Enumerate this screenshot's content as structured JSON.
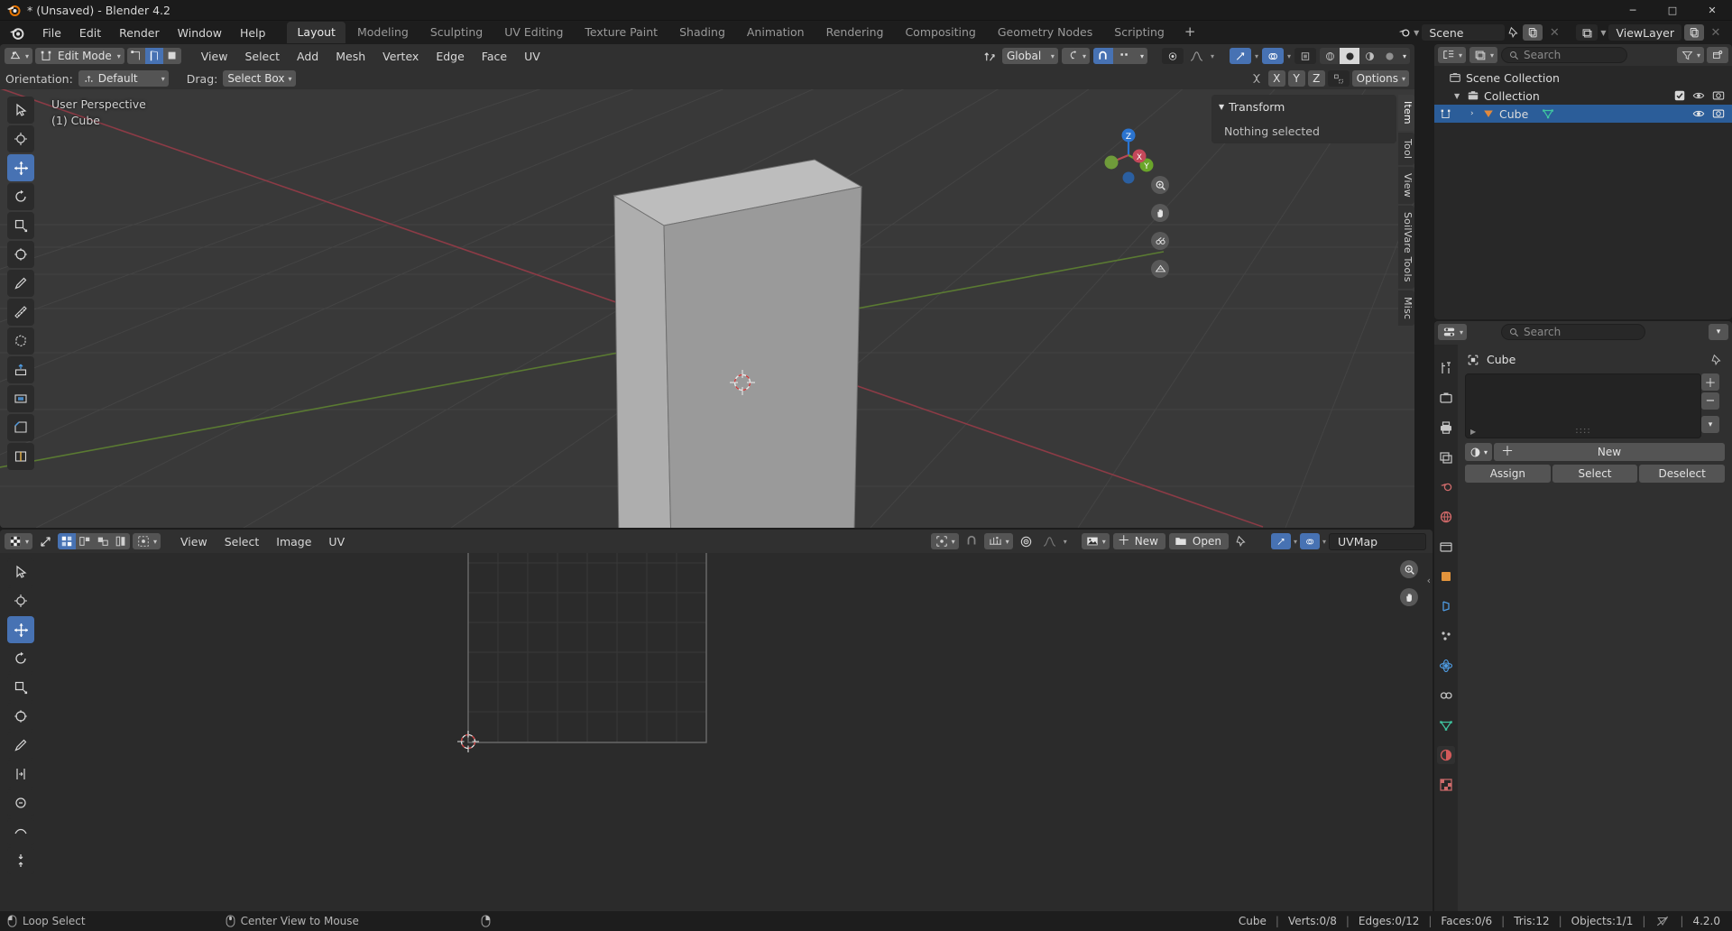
{
  "window": {
    "title": "* (Unsaved) - Blender 4.2",
    "minimize": "─",
    "maximize": "□",
    "close": "✕"
  },
  "topbar": {
    "menus": [
      "File",
      "Edit",
      "Render",
      "Window",
      "Help"
    ],
    "workspaces": [
      {
        "label": "Layout",
        "active": true
      },
      {
        "label": "Modeling",
        "active": false
      },
      {
        "label": "Sculpting",
        "active": false
      },
      {
        "label": "UV Editing",
        "active": false
      },
      {
        "label": "Texture Paint",
        "active": false
      },
      {
        "label": "Shading",
        "active": false
      },
      {
        "label": "Animation",
        "active": false
      },
      {
        "label": "Rendering",
        "active": false
      },
      {
        "label": "Compositing",
        "active": false
      },
      {
        "label": "Geometry Nodes",
        "active": false
      },
      {
        "label": "Scripting",
        "active": false
      }
    ],
    "add_workspace": "+",
    "scene_name": "Scene",
    "viewlayer_name": "ViewLayer"
  },
  "viewport3d": {
    "mode": "Edit Mode",
    "menus": [
      "View",
      "Select",
      "Add",
      "Mesh",
      "Vertex",
      "Edge",
      "Face",
      "UV"
    ],
    "mesh_select_modes": [
      {
        "name": "vertex-select-mode",
        "active": false
      },
      {
        "name": "edge-select-mode",
        "active": true
      },
      {
        "name": "face-select-mode",
        "active": false
      }
    ],
    "transform_orientation": "Global",
    "overlay_label": "",
    "toolsettings": {
      "orientation_label": "Orientation:",
      "orientation_value": "Default",
      "drag_label": "Drag:",
      "drag_value": "Select Box",
      "proportional_axes": [
        "X",
        "Y",
        "Z"
      ],
      "options_label": "Options"
    },
    "overlay_text_line1": "User Perspective",
    "overlay_text_line2": "(1) Cube",
    "gizmo_axes": {
      "z": "Z",
      "y": "Y",
      "x": "X"
    },
    "sidebar": {
      "panel_title": "Transform",
      "panel_body": "Nothing selected",
      "tabs": [
        "Item",
        "Tool",
        "View",
        "SoilVare Tools",
        "Misc"
      ]
    },
    "tools": [
      {
        "name": "tweak-tool",
        "active": false
      },
      {
        "name": "cursor-tool",
        "active": false
      },
      {
        "name": "move-tool",
        "active": true
      },
      {
        "name": "rotate-tool",
        "active": false
      },
      {
        "name": "scale-tool",
        "active": false
      },
      {
        "name": "transform-tool",
        "active": false
      },
      {
        "name": "annotate-tool",
        "active": false
      },
      {
        "name": "measure-tool",
        "active": false
      },
      {
        "name": "add-cube-tool",
        "active": false
      },
      {
        "name": "extrude-region-tool",
        "active": false
      },
      {
        "name": "inset-faces-tool",
        "active": false
      },
      {
        "name": "bevel-tool",
        "active": false
      },
      {
        "name": "loop-cut-tool",
        "active": false
      }
    ]
  },
  "uveditor": {
    "menus": [
      "View",
      "Select",
      "Image",
      "UV"
    ],
    "uv_select_modes": [
      {
        "name": "uv-vertex-select",
        "active": true
      },
      {
        "name": "uv-edge-select",
        "active": false
      },
      {
        "name": "uv-face-select",
        "active": false
      },
      {
        "name": "uv-island-select",
        "active": false
      }
    ],
    "new_label": "New",
    "open_label": "Open",
    "uvmap_name": "UVMap",
    "tools": [
      {
        "name": "uv-tweak-tool",
        "active": false
      },
      {
        "name": "uv-cursor-tool",
        "active": false
      },
      {
        "name": "uv-move-tool",
        "active": true
      },
      {
        "name": "uv-rotate-tool",
        "active": false
      },
      {
        "name": "uv-scale-tool",
        "active": false
      },
      {
        "name": "uv-transform-tool",
        "active": false
      },
      {
        "name": "uv-annotate-tool",
        "active": false
      },
      {
        "name": "uv-rip-region-tool",
        "active": false
      },
      {
        "name": "uv-grab-tool",
        "active": false
      },
      {
        "name": "uv-relax-tool",
        "active": false
      },
      {
        "name": "uv-pinch-tool",
        "active": false
      }
    ]
  },
  "outliner": {
    "search_placeholder": "Search",
    "rows": [
      {
        "label": "Scene Collection",
        "indent": 0,
        "icon": "collection-icon",
        "selected": false,
        "has_expand": false,
        "checkbox": false,
        "eye": false,
        "camera": false
      },
      {
        "label": "Collection",
        "indent": 1,
        "icon": "collection-icon",
        "selected": false,
        "has_expand": true,
        "checkbox": true,
        "eye": true,
        "camera": true
      },
      {
        "label": "Cube",
        "indent": 2,
        "icon": "mesh-object-icon",
        "selected": true,
        "has_expand": true,
        "checkbox": false,
        "eye": true,
        "camera": true
      }
    ]
  },
  "properties": {
    "search_placeholder": "Search",
    "object_name": "Cube",
    "material_new_label": "New",
    "buttons": [
      "Assign",
      "Select",
      "Deselect"
    ],
    "tabs": [
      {
        "name": "tool-properties-tab",
        "active": false
      },
      {
        "name": "render-properties-tab",
        "active": false
      },
      {
        "name": "output-properties-tab",
        "active": false
      },
      {
        "name": "view-layer-properties-tab",
        "active": false
      },
      {
        "name": "scene-properties-tab",
        "active": false
      },
      {
        "name": "world-properties-tab",
        "active": false
      },
      {
        "name": "collection-properties-tab",
        "active": false
      },
      {
        "name": "object-properties-tab",
        "active": false
      },
      {
        "name": "modifier-properties-tab",
        "active": false
      },
      {
        "name": "particle-properties-tab",
        "active": false
      },
      {
        "name": "physics-properties-tab",
        "active": false
      },
      {
        "name": "constraint-properties-tab",
        "active": false
      },
      {
        "name": "object-data-properties-tab",
        "active": false
      },
      {
        "name": "material-properties-tab",
        "active": true
      },
      {
        "name": "texture-properties-tab",
        "active": false
      }
    ]
  },
  "statusbar": {
    "keymap": [
      {
        "icon": "mouse-left-icon",
        "label": "Loop Select"
      },
      {
        "icon": "mouse-middle-icon",
        "label": "Center View to Mouse"
      },
      {
        "icon": "mouse-right-icon",
        "label": ""
      }
    ],
    "stats": [
      "Cube",
      "Verts:0/8",
      "Edges:0/12",
      "Faces:0/6",
      "Tris:12",
      "Objects:1/1"
    ],
    "version": "4.2.0"
  },
  "colors": {
    "accent_blue": "#4772b3",
    "select_row": "#2b5d99",
    "bg_dark": "#1d1d1d",
    "bg_panel": "#303030",
    "viewport_bg": "#393939",
    "axis_x": "#c4485a",
    "axis_y": "#6aa52a",
    "axis_z": "#2b74d0",
    "cube_face_light": "#b4b4b4",
    "cube_face_mid": "#a0a0a0",
    "cube_face_dark": "#8d8d8d"
  }
}
